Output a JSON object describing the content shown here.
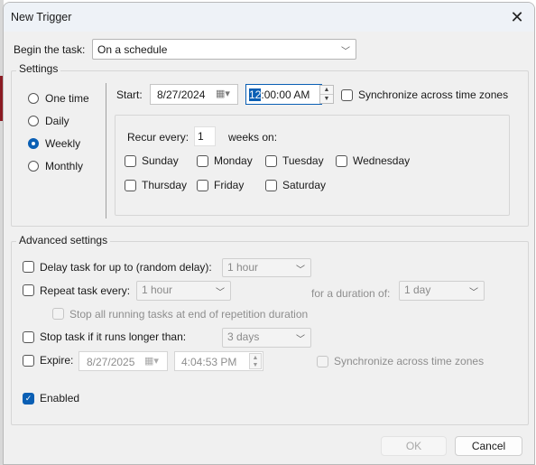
{
  "dialog": {
    "title": "New Trigger",
    "close_icon": "close-icon"
  },
  "begin_task": {
    "label": "Begin the task:",
    "value": "On a schedule"
  },
  "settings": {
    "legend": "Settings",
    "schedule_options": [
      {
        "label": "One time",
        "checked": false
      },
      {
        "label": "Daily",
        "checked": false
      },
      {
        "label": "Weekly",
        "checked": true
      },
      {
        "label": "Monthly",
        "checked": false
      }
    ],
    "start_label": "Start:",
    "start_date": "8/27/2024",
    "start_time_selected": "12",
    "start_time_rest": ":00:00 AM",
    "sync_label": "Synchronize across time zones",
    "recur_label": "Recur every:",
    "recur_value": "1",
    "weeks_on_label": "weeks on:",
    "days": [
      {
        "label": "Sunday",
        "checked": false
      },
      {
        "label": "Monday",
        "checked": false
      },
      {
        "label": "Tuesday",
        "checked": false
      },
      {
        "label": "Wednesday",
        "checked": false
      },
      {
        "label": "Thursday",
        "checked": false
      },
      {
        "label": "Friday",
        "checked": false
      },
      {
        "label": "Saturday",
        "checked": false
      }
    ]
  },
  "advanced": {
    "legend": "Advanced settings",
    "delay_label": "Delay task for up to (random delay):",
    "delay_value": "1 hour",
    "repeat_label": "Repeat task every:",
    "repeat_value": "1 hour",
    "duration_label": "for a duration of:",
    "duration_value": "1 day",
    "stop_all_label": "Stop all running tasks at end of repetition duration",
    "stop_longer_label": "Stop task if it runs longer than:",
    "stop_longer_value": "3 days",
    "expire_label": "Expire:",
    "expire_date": "8/27/2025",
    "expire_time": "4:04:53 PM",
    "expire_sync_label": "Synchronize across time zones",
    "enabled_label": "Enabled",
    "enabled_checked": true
  },
  "buttons": {
    "ok": "OK",
    "cancel": "Cancel"
  }
}
